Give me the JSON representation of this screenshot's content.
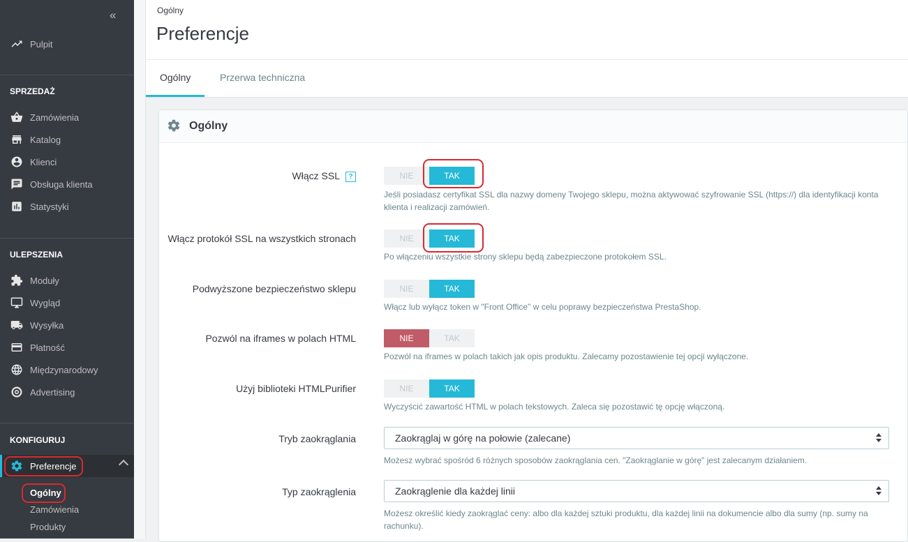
{
  "sidebar": {
    "collapse_glyph": "«",
    "dashboard": {
      "label": "Pulpit",
      "icon": "trending-up-icon"
    },
    "sections": [
      {
        "title": "SPRZEDAŻ",
        "items": [
          {
            "label": "Zamówienia",
            "icon": "basket-icon"
          },
          {
            "label": "Katalog",
            "icon": "store-icon"
          },
          {
            "label": "Klienci",
            "icon": "account-circle-icon"
          },
          {
            "label": "Obsługa klienta",
            "icon": "chat-icon"
          },
          {
            "label": "Statystyki",
            "icon": "bar-chart-icon"
          }
        ]
      },
      {
        "title": "ULEPSZENIA",
        "items": [
          {
            "label": "Moduły",
            "icon": "puzzle-icon"
          },
          {
            "label": "Wygląd",
            "icon": "desktop-icon"
          },
          {
            "label": "Wysyłka",
            "icon": "truck-icon"
          },
          {
            "label": "Płatność",
            "icon": "credit-card-icon"
          },
          {
            "label": "Międzynarodowy",
            "icon": "globe-icon"
          },
          {
            "label": "Advertising",
            "icon": "target-icon"
          }
        ]
      },
      {
        "title": "KONFIGURUJ",
        "items": [
          {
            "label": "Preferencje",
            "icon": "gear-icon",
            "active": true,
            "subitems": [
              "Ogólny",
              "Zamówienia",
              "Produkty"
            ]
          }
        ]
      }
    ]
  },
  "header": {
    "breadcrumb": "Ogólny",
    "title": "Preferencje",
    "tabs": [
      {
        "label": "Ogólny",
        "active": true
      },
      {
        "label": "Przerwa techniczna",
        "active": false
      }
    ]
  },
  "panel": {
    "title": "Ogólny",
    "rows": [
      {
        "label": "Włącz SSL",
        "type": "switch",
        "value": "TAK",
        "no": "NIE",
        "yes": "TAK",
        "help": "Jeśli posiadasz certyfikat SSL dla nazwy domeny Twojego sklepu, można aktywować szyfrowanie SSL (https://) dla identyfikacji konta klienta i realizacji zamówień.",
        "help_icon": "?"
      },
      {
        "label": "Włącz protokół SSL na wszystkich stronach",
        "type": "switch",
        "value": "TAK",
        "no": "NIE",
        "yes": "TAK",
        "help": "Po włączeniu wszystkie strony sklepu będą zabezpieczone protokołem SSL."
      },
      {
        "label": "Podwyższone bezpieczeństwo sklepu",
        "type": "switch",
        "value": "TAK",
        "no": "NIE",
        "yes": "TAK",
        "help": "Włącz lub wyłącz token w \"Front Office\" w celu poprawy bezpieczeństwa PrestaShop."
      },
      {
        "label": "Pozwól na iframes w polach HTML",
        "type": "switch",
        "value": "NIE",
        "no": "NIE",
        "yes": "TAK",
        "help": "Pozwól na iframes w polach takich jak opis produktu. Zalecamy pozostawienie tej opcji wyłączone."
      },
      {
        "label": "Użyj biblioteki HTMLPurifier",
        "type": "switch",
        "value": "TAK",
        "no": "NIE",
        "yes": "TAK",
        "help": "Wyczyścić zawartość HTML w polach tekstowych. Zaleca się pozostawić tę opcję włączoną."
      },
      {
        "label": "Tryb zaokrąglania",
        "type": "select",
        "value": "Zaokrąglaj w górę na połowie (zalecane)",
        "help": "Możesz wybrać spośród 6 różnych sposobów zaokrąglania cen. \"Zaokrąglanie w górę\" jest zalecanym działaniem."
      },
      {
        "label": "Typ zaokrąglenia",
        "type": "select",
        "value": "Zaokrąglenie dla każdej linii",
        "help": "Możesz określić kiedy zaokrąglać ceny: albo dla każdej sztuki produktu, dla każdej linii na dokumencie albo dla sumy (np. sumy na rachunku)."
      }
    ]
  },
  "colors": {
    "accent": "#25b9d7",
    "danger": "#c05c67",
    "sidebar_bg": "#363a41",
    "highlight_ring": "#d9292e"
  }
}
